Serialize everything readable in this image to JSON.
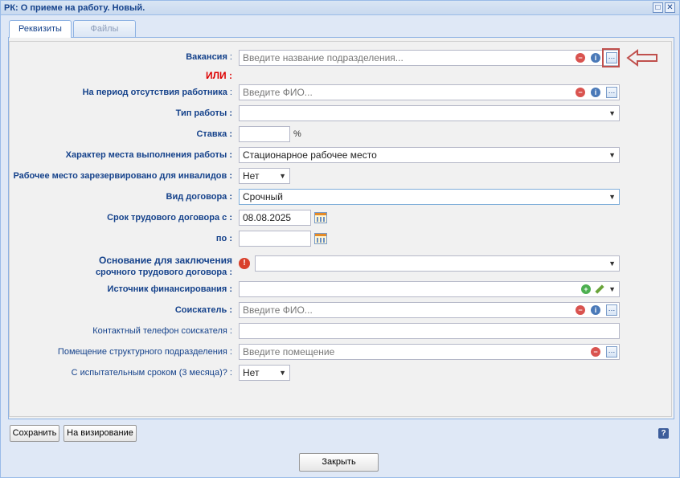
{
  "window": {
    "title": "РК: О приеме на работу. Новый."
  },
  "tabs": [
    {
      "label": "Реквизиты"
    },
    {
      "label": "Файлы"
    }
  ],
  "form": {
    "vacancy": {
      "label": "Вакансия",
      "placeholder": "Введите название подразделения..."
    },
    "or_label": "ИЛИ :",
    "absence_period": {
      "label": "На период отсутствия работника",
      "placeholder": "Введите ФИО..."
    },
    "work_type": {
      "label": "Тип работы :",
      "value": ""
    },
    "rate": {
      "label": "Ставка :",
      "value": "",
      "unit": "%"
    },
    "workplace_character": {
      "label": "Характер места выполнения работы :",
      "value": "Стационарное рабочее место"
    },
    "reserved_disabled": {
      "label": "Рабочее место зарезервировано для инвалидов :",
      "value": "Нет"
    },
    "contract_type": {
      "label": "Вид договора :",
      "value": "Срочный"
    },
    "contract_from": {
      "label": "Срок трудового договора с :",
      "value": "08.08.2025"
    },
    "contract_to": {
      "label": "по :",
      "value": ""
    },
    "basis": {
      "label_line1": "Основание для заключения",
      "label_line2": "срочного трудового договора :",
      "value": ""
    },
    "funding": {
      "label": "Источник финансирования :",
      "value": ""
    },
    "applicant": {
      "label": "Соискатель :",
      "placeholder": "Введите ФИО..."
    },
    "applicant_phone": {
      "label": "Контактный телефон соискателя",
      "value": ""
    },
    "premises": {
      "label": "Помещение структурного подразделения",
      "placeholder": "Введите помещение"
    },
    "probation": {
      "label": "С испытательным сроком (3 месяца)?",
      "value": "Нет"
    }
  },
  "buttons": {
    "save": "Сохранить",
    "approve": "На визирование",
    "close": "Закрыть",
    "help": "?"
  },
  "colors": {
    "label": "#15428b",
    "accent_red": "#d00000",
    "highlight": "#c0504d"
  }
}
